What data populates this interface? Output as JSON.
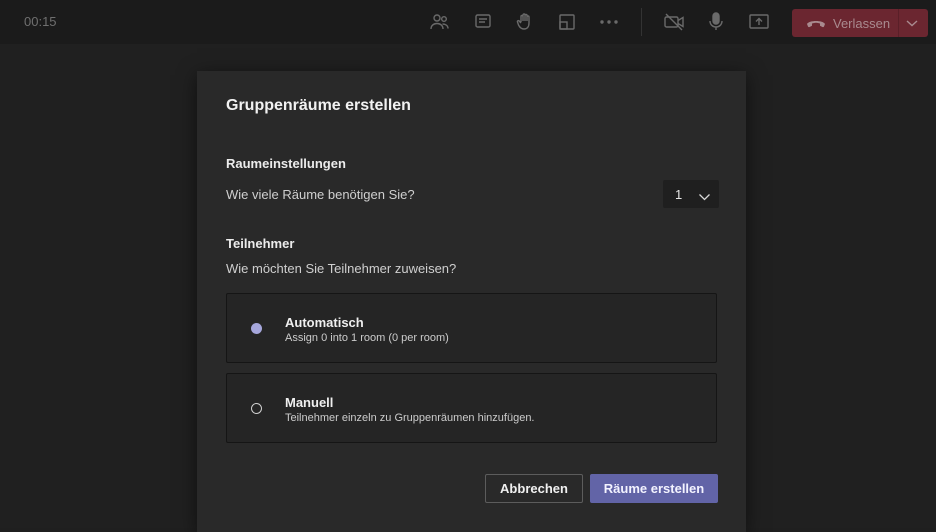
{
  "topbar": {
    "timer": "00:15",
    "icons": [
      "participants-icon",
      "chat-icon",
      "raise-hand-icon",
      "breakout-rooms-icon",
      "more-options-icon",
      "camera-off-icon",
      "microphone-icon",
      "share-screen-icon"
    ],
    "leave_label": "Verlassen"
  },
  "dialog": {
    "title": "Gruppenräume erstellen",
    "room_settings_heading": "Raumeinstellungen",
    "room_count_question": "Wie viele Räume benötigen Sie?",
    "room_count_value": "1",
    "participants_heading": "Teilnehmer",
    "assign_question": "Wie möchten Sie Teilnehmer zuweisen?",
    "options": [
      {
        "title": "Automatisch",
        "subtitle": "Assign 0 into 1 room (0 per room)",
        "selected": true
      },
      {
        "title": "Manuell",
        "subtitle": "Teilnehmer einzeln zu Gruppenräumen hinzufügen.",
        "selected": false
      }
    ],
    "cancel_label": "Abbrechen",
    "create_label": "Räume erstellen"
  },
  "colors": {
    "accent": "#6264a7",
    "leave": "#6b2630",
    "modal_bg": "#292929"
  }
}
